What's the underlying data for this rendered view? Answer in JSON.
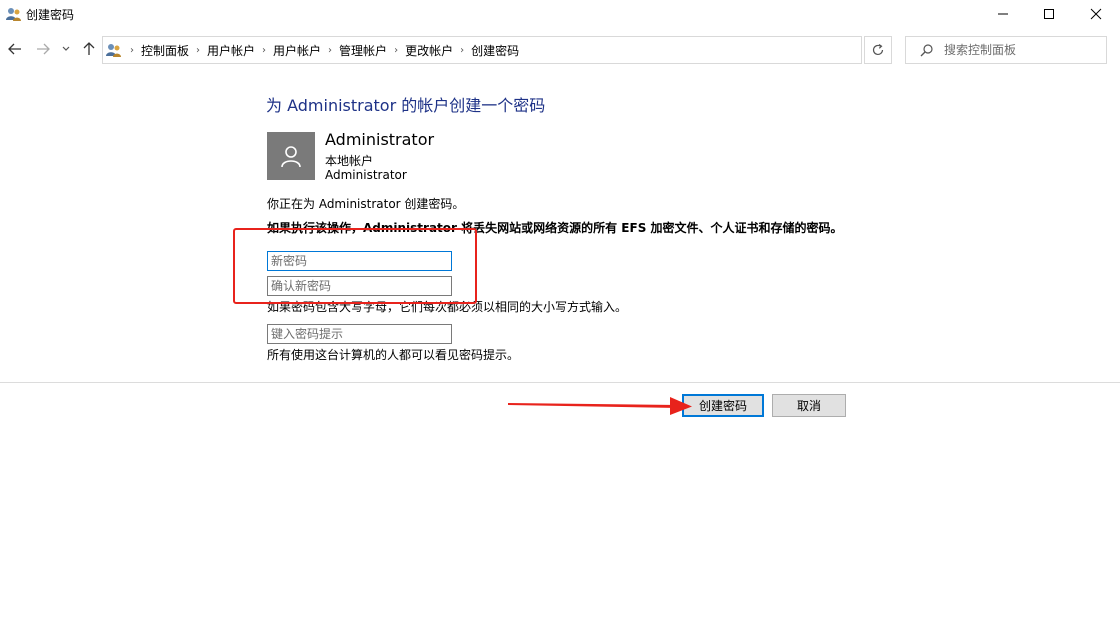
{
  "window": {
    "title": "创建密码"
  },
  "nav": {
    "breadcrumbs": [
      "控制面板",
      "用户帐户",
      "用户帐户",
      "管理帐户",
      "更改帐户",
      "创建密码"
    ],
    "search_placeholder": "搜索控制面板"
  },
  "content": {
    "heading": "为 Administrator 的帐户创建一个密码",
    "account_name": "Administrator",
    "account_type": "本地帐户",
    "account_sub": "Administrator",
    "info": "你正在为 Administrator 创建密码。",
    "warning": "如果执行该操作，Administrator 将丢失网站或网络资源的所有 EFS 加密文件、个人证书和存储的密码。",
    "new_password_placeholder": "新密码",
    "confirm_password_placeholder": "确认新密码",
    "case_note": "如果密码包含大写字母，它们每次都必须以相同的大小写方式输入。",
    "hint_placeholder": "键入密码提示",
    "hint_note": "所有使用这台计算机的人都可以看见密码提示。"
  },
  "buttons": {
    "create": "创建密码",
    "cancel": "取消"
  },
  "colors": {
    "heading": "#1e3287",
    "accent": "#0078d7",
    "annotation": "#e8231c"
  }
}
